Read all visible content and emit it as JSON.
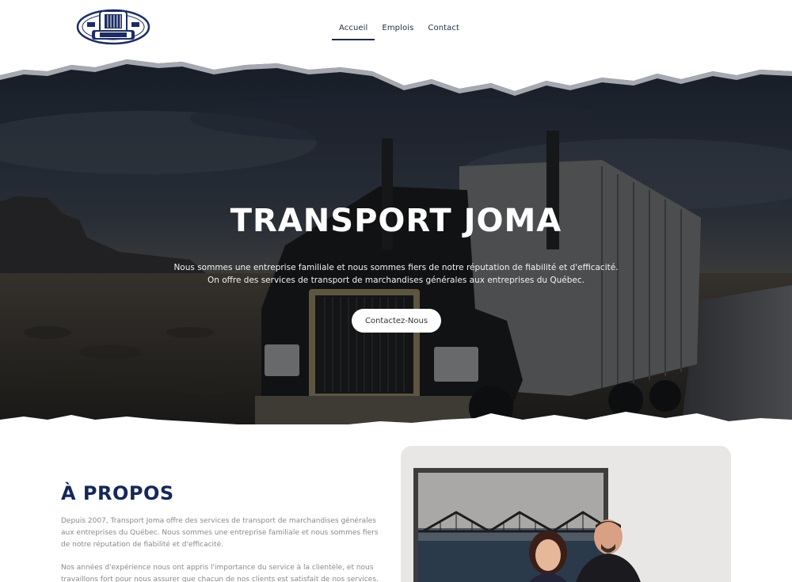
{
  "header": {
    "logo_alt": "Transport Joma logo",
    "nav": [
      {
        "label": "Accueil",
        "active": true
      },
      {
        "label": "Emplois",
        "active": false
      },
      {
        "label": "Contact",
        "active": false
      }
    ]
  },
  "hero": {
    "title": "TRANSPORT JOMA",
    "line1": "Nous sommes une entreprise familiale et nous sommes fiers de notre réputation de fiabilité et d'efficacité.",
    "line2": "On offre des services de transport de marchandises générales aux entreprises du Québec.",
    "cta": "Contactez-Nous"
  },
  "about": {
    "title": "À PROPOS",
    "paragraph1": "Depuis 2007, Transport Joma offre des services de transport de marchandises générales aux entreprises du Québec. Nous sommes une entreprise familiale et nous sommes fiers de notre réputation de fiabilité et d'efficacité.",
    "paragraph2": "Nos années d'expérience nous ont appris l'importance du service à la clientèle, et nous travaillons fort pour nous assurer que chacun de nos clients est satisfait de nos services."
  },
  "colors": {
    "brand_navy": "#16275a",
    "nav_text": "#1f2a44",
    "body_gray": "#8a8a8a"
  }
}
